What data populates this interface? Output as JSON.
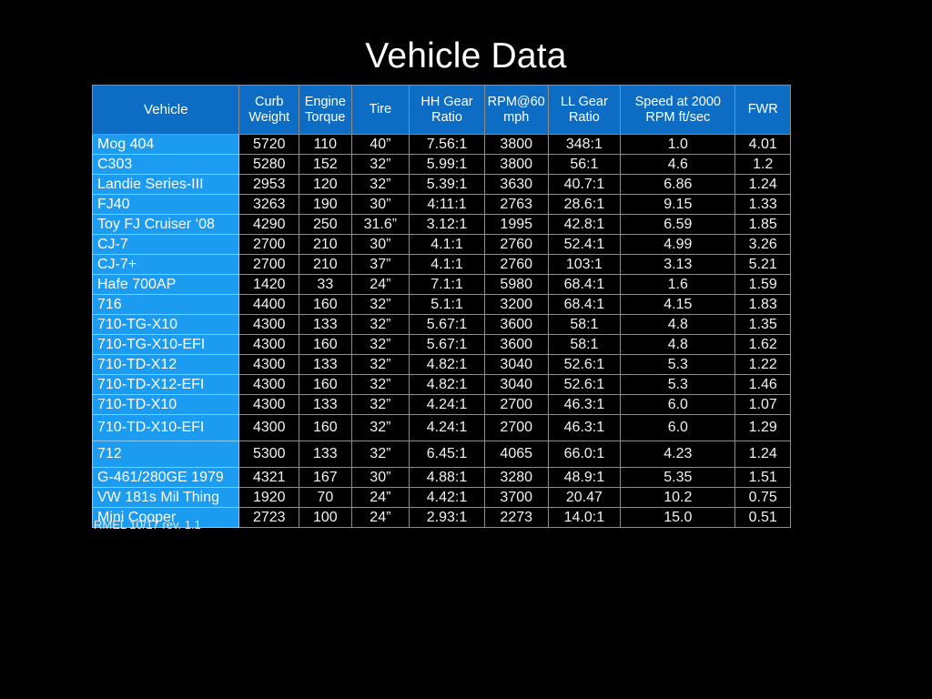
{
  "title": "Vehicle Data",
  "footer": "RMEL 10/17 rev. 1.1",
  "colors": {
    "background": "#000000",
    "header_blue": "#0d6dc4",
    "row_label_blue": "#1c9cf0",
    "grid_line": "#8c8c8c",
    "text": "#ffffff"
  },
  "table": {
    "headers": [
      "Vehicle",
      "Curb Weight",
      "Engine Torque",
      "Tire",
      "HH Gear Ratio",
      "RPM@60 mph",
      "LL Gear Ratio",
      "Speed at 2000 RPM ft/sec",
      "FWR"
    ],
    "header_lines": [
      [
        "Vehicle"
      ],
      [
        "Curb",
        "Weight"
      ],
      [
        "Engine",
        "Torque"
      ],
      [
        "Tire"
      ],
      [
        "HH Gear",
        "Ratio"
      ],
      [
        "RPM@60",
        "mph"
      ],
      [
        "LL Gear",
        "Ratio"
      ],
      [
        "Speed at 2000",
        "RPM ft/sec"
      ],
      [
        "FWR"
      ]
    ],
    "rows": [
      {
        "vehicle": "Mog 404",
        "curb_weight": "5720",
        "engine_torque": "110",
        "tire": "40”",
        "hh_gear_ratio": "7.56:1",
        "rpm_at_60": "3800",
        "ll_gear_ratio": "348:1",
        "speed_2000rpm": "1.0",
        "fwr": "4.01",
        "tall": false
      },
      {
        "vehicle": "C303",
        "curb_weight": "5280",
        "engine_torque": "152",
        "tire": "32”",
        "hh_gear_ratio": "5.99:1",
        "rpm_at_60": "3800",
        "ll_gear_ratio": "56:1",
        "speed_2000rpm": "4.6",
        "fwr": "1.2",
        "tall": false
      },
      {
        "vehicle": "Landie Series-III",
        "curb_weight": "2953",
        "engine_torque": "120",
        "tire": "32”",
        "hh_gear_ratio": "5.39:1",
        "rpm_at_60": "3630",
        "ll_gear_ratio": "40.7:1",
        "speed_2000rpm": "6.86",
        "fwr": "1.24",
        "tall": false
      },
      {
        "vehicle": "FJ40",
        "curb_weight": "3263",
        "engine_torque": "190",
        "tire": "30”",
        "hh_gear_ratio": "4:11:1",
        "rpm_at_60": "2763",
        "ll_gear_ratio": "28.6:1",
        "speed_2000rpm": "9.15",
        "fwr": "1.33",
        "tall": false
      },
      {
        "vehicle": "Toy FJ Cruiser ‘08",
        "curb_weight": "4290",
        "engine_torque": "250",
        "tire": "31.6”",
        "hh_gear_ratio": "3.12:1",
        "rpm_at_60": "1995",
        "ll_gear_ratio": "42.8:1",
        "speed_2000rpm": "6.59",
        "fwr": "1.85",
        "tall": false
      },
      {
        "vehicle": "CJ-7",
        "curb_weight": "2700",
        "engine_torque": "210",
        "tire": "30”",
        "hh_gear_ratio": "4.1:1",
        "rpm_at_60": "2760",
        "ll_gear_ratio": "52.4:1",
        "speed_2000rpm": "4.99",
        "fwr": "3.26",
        "tall": false
      },
      {
        "vehicle": "CJ-7+",
        "curb_weight": "2700",
        "engine_torque": "210",
        "tire": "37”",
        "hh_gear_ratio": "4.1:1",
        "rpm_at_60": "2760",
        "ll_gear_ratio": "103:1",
        "speed_2000rpm": "3.13",
        "fwr": "5.21",
        "tall": false
      },
      {
        "vehicle": "Hafe 700AP",
        "curb_weight": "1420",
        "engine_torque": "33",
        "tire": "24”",
        "hh_gear_ratio": "7.1:1",
        "rpm_at_60": "5980",
        "ll_gear_ratio": "68.4:1",
        "speed_2000rpm": "1.6",
        "fwr": "1.59",
        "tall": false
      },
      {
        "vehicle": "716",
        "curb_weight": "4400",
        "engine_torque": "160",
        "tire": "32”",
        "hh_gear_ratio": "5.1:1",
        "rpm_at_60": "3200",
        "ll_gear_ratio": "68.4:1",
        "speed_2000rpm": "4.15",
        "fwr": "1.83",
        "tall": false
      },
      {
        "vehicle": "710-TG-X10",
        "curb_weight": "4300",
        "engine_torque": "133",
        "tire": "32”",
        "hh_gear_ratio": "5.67:1",
        "rpm_at_60": "3600",
        "ll_gear_ratio": "58:1",
        "speed_2000rpm": "4.8",
        "fwr": "1.35",
        "tall": false
      },
      {
        "vehicle": "710-TG-X10-EFI",
        "curb_weight": "4300",
        "engine_torque": "160",
        "tire": "32”",
        "hh_gear_ratio": "5.67:1",
        "rpm_at_60": "3600",
        "ll_gear_ratio": "58:1",
        "speed_2000rpm": "4.8",
        "fwr": "1.62",
        "tall": false
      },
      {
        "vehicle": "710-TD-X12",
        "curb_weight": "4300",
        "engine_torque": "133",
        "tire": "32”",
        "hh_gear_ratio": "4.82:1",
        "rpm_at_60": "3040",
        "ll_gear_ratio": "52.6:1",
        "speed_2000rpm": "5.3",
        "fwr": "1.22",
        "tall": false
      },
      {
        "vehicle": "710-TD-X12-EFI",
        "curb_weight": "4300",
        "engine_torque": "160",
        "tire": "32”",
        "hh_gear_ratio": "4.82:1",
        "rpm_at_60": "3040",
        "ll_gear_ratio": "52.6:1",
        "speed_2000rpm": "5.3",
        "fwr": "1.46",
        "tall": false
      },
      {
        "vehicle": "710-TD-X10",
        "curb_weight": "4300",
        "engine_torque": "133",
        "tire": "32”",
        "hh_gear_ratio": "4.24:1",
        "rpm_at_60": "2700",
        "ll_gear_ratio": "46.3:1",
        "speed_2000rpm": "6.0",
        "fwr": "1.07",
        "tall": false
      },
      {
        "vehicle": "710-TD-X10-EFI",
        "curb_weight": "4300",
        "engine_torque": "160",
        "tire": "32”",
        "hh_gear_ratio": "4.24:1",
        "rpm_at_60": "2700",
        "ll_gear_ratio": "46.3:1",
        "speed_2000rpm": "6.0",
        "fwr": "1.29",
        "tall": true
      },
      {
        "vehicle": "712",
        "curb_weight": "5300",
        "engine_torque": "133",
        "tire": "32”",
        "hh_gear_ratio": "6.45:1",
        "rpm_at_60": "4065",
        "ll_gear_ratio": "66.0:1",
        "speed_2000rpm": "4.23",
        "fwr": "1.24",
        "tall": true
      },
      {
        "vehicle": "G-461/280GE 1979",
        "curb_weight": "4321",
        "engine_torque": "167",
        "tire": "30”",
        "hh_gear_ratio": "4.88:1",
        "rpm_at_60": "3280",
        "ll_gear_ratio": "48.9:1",
        "speed_2000rpm": "5.35",
        "fwr": "1.51",
        "tall": false
      },
      {
        "vehicle": "VW 181s Mil Thing",
        "curb_weight": "1920",
        "engine_torque": "70",
        "tire": "24”",
        "hh_gear_ratio": "4.42:1",
        "rpm_at_60": "3700",
        "ll_gear_ratio": "20.47",
        "speed_2000rpm": "10.2",
        "fwr": "0.75",
        "tall": false
      },
      {
        "vehicle": "Mini Cooper",
        "curb_weight": "2723",
        "engine_torque": "100",
        "tire": "24”",
        "hh_gear_ratio": "2.93:1",
        "rpm_at_60": "2273",
        "ll_gear_ratio": "14.0:1",
        "speed_2000rpm": "15.0",
        "fwr": "0.51",
        "tall": false
      }
    ]
  }
}
